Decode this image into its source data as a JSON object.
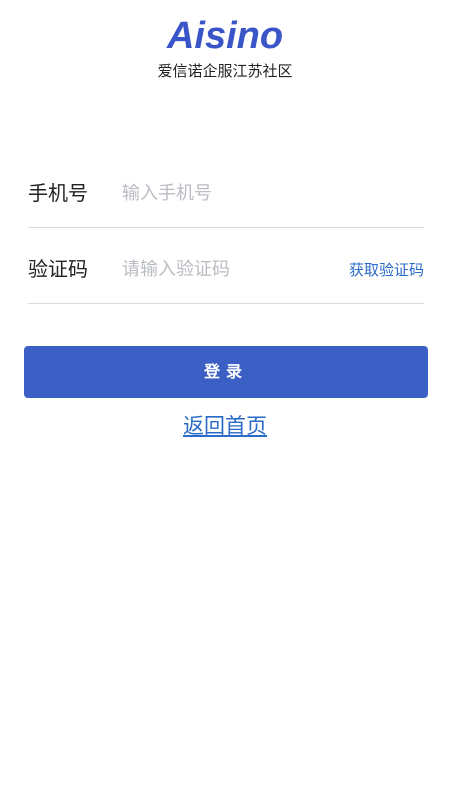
{
  "header": {
    "logo_text": "Aisino",
    "subtitle": "爱信诺企服江苏社区"
  },
  "form": {
    "phone": {
      "label": "手机号",
      "placeholder": "输入手机号",
      "value": ""
    },
    "code": {
      "label": "验证码",
      "placeholder": "请输入验证码",
      "value": "",
      "get_code_label": "获取验证码"
    },
    "login_label": "登录",
    "back_home_label": "返回首页"
  },
  "colors": {
    "brand": "#3a55c7",
    "button": "#3b5fc4",
    "link": "#2a6ac8",
    "placeholder": "#b9bcc2",
    "divider": "#dcdcdc"
  }
}
